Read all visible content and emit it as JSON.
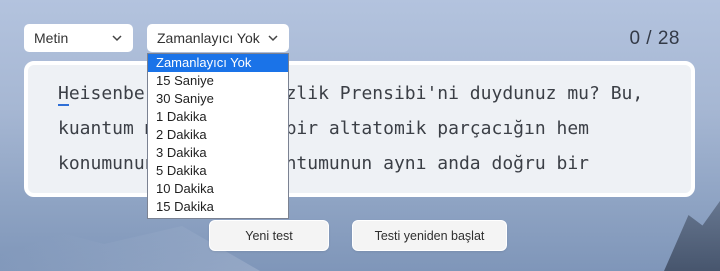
{
  "mode_select": {
    "value": "Metin",
    "icon": "chevron-down-icon"
  },
  "timer_select": {
    "value": "Zamanlayıcı Yok",
    "icon": "chevron-down-icon",
    "options": [
      "Zamanlayıcı Yok",
      "15 Saniye",
      "30 Saniye",
      "1 Dakika",
      "2 Dakika",
      "3 Dakika",
      "5 Dakika",
      "10 Dakika",
      "15 Dakika"
    ],
    "selected_index": 0
  },
  "counter": "0 / 28",
  "text": {
    "caret_char": "H",
    "lines": [
      "eisenberg'in Belirsizlik Prensibi'ni duydunuz mu? Bu,",
      "kuantum mekaniğinde, bir altatomik parçacığın hem",
      "konumunun hem de momentumunun aynı anda doğru bir"
    ]
  },
  "buttons": {
    "new_test": "Yeni test",
    "restart_test": "Testi yeniden başlat"
  },
  "colors": {
    "accent": "#1a73e8",
    "caret": "#2f6fd6",
    "card_bg": "#eef1f5"
  }
}
